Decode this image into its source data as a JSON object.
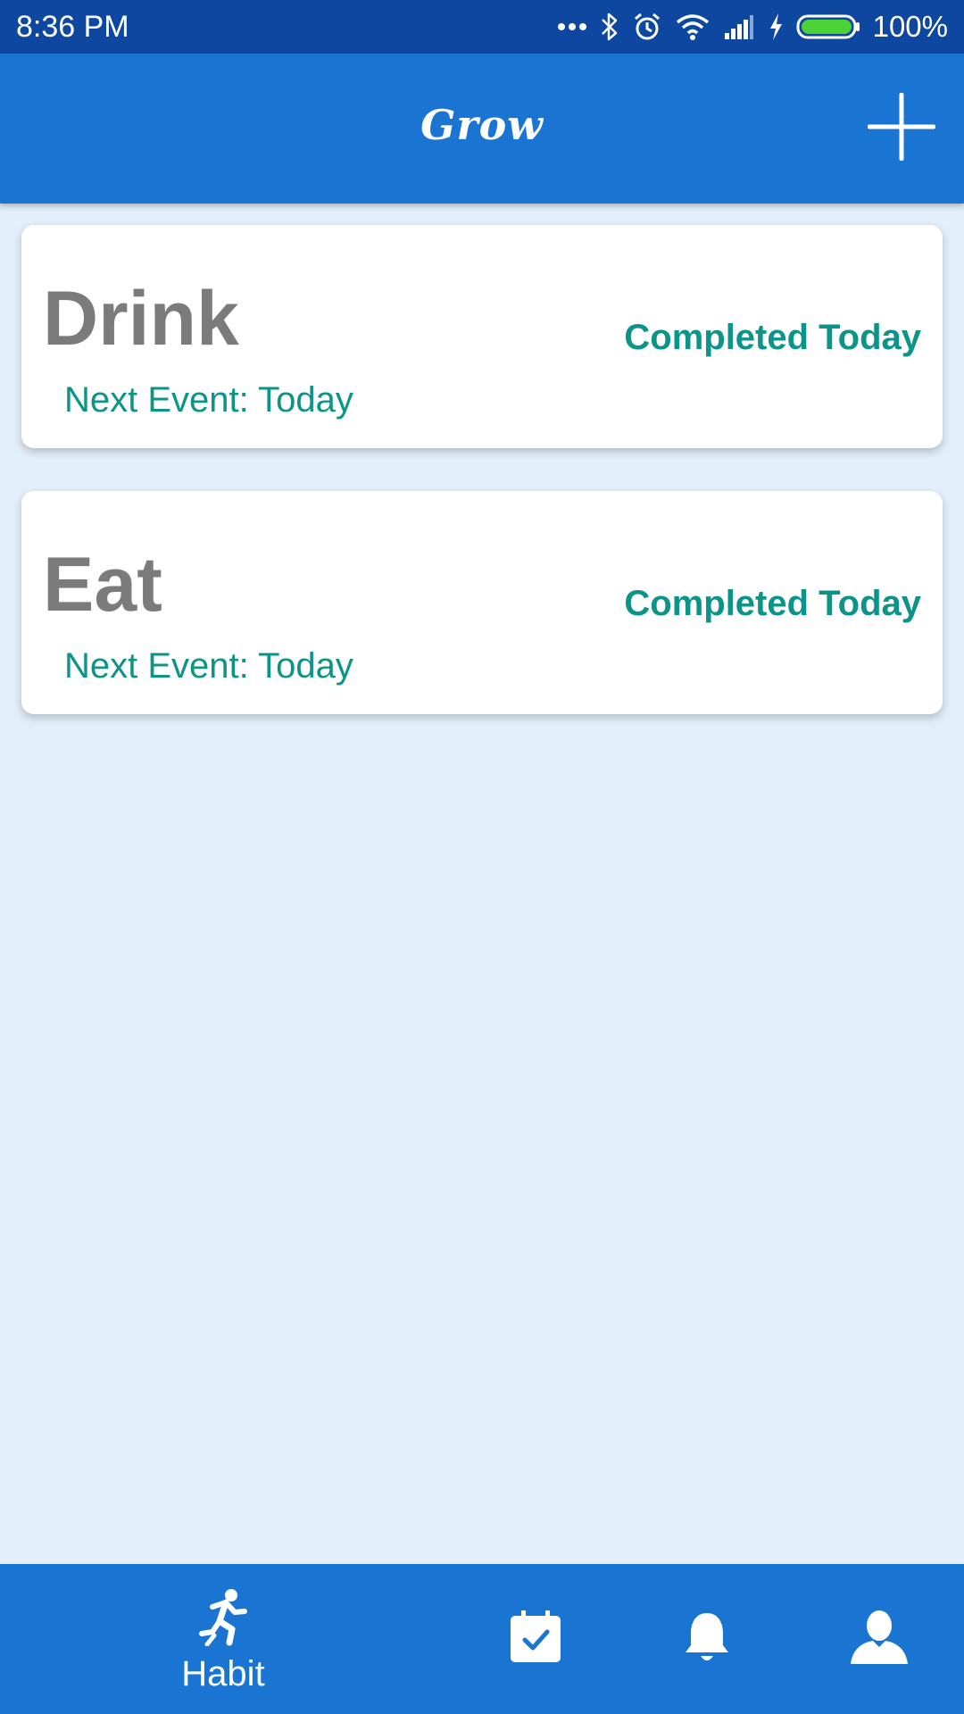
{
  "status_bar": {
    "time": "8:36 PM",
    "battery": "100%",
    "icons": [
      "more-dots-icon",
      "bluetooth-icon",
      "alarm-icon",
      "wifi-icon",
      "signal-icon",
      "charging-icon",
      "battery-icon"
    ]
  },
  "app_bar": {
    "title": "Grow",
    "add_icon": "plus-icon"
  },
  "habits": [
    {
      "name": "Drink",
      "status": "Completed Today",
      "next_event": "Next Event: Today"
    },
    {
      "name": "Eat",
      "status": "Completed Today",
      "next_event": "Next Event: Today"
    }
  ],
  "bottom_nav": {
    "items": [
      {
        "label": "Habit",
        "icon": "running-person-icon",
        "active": true
      },
      {
        "label": "",
        "icon": "calendar-check-icon",
        "active": false
      },
      {
        "label": "",
        "icon": "bell-icon",
        "active": false
      },
      {
        "label": "",
        "icon": "person-icon",
        "active": false
      }
    ]
  },
  "colors": {
    "status_bar": "#0e47a0",
    "primary": "#1a75d2",
    "background": "#e3effa",
    "accent_teal": "#0c9488",
    "habit_name": "#7b7b7b",
    "battery_green": "#4cd137"
  }
}
